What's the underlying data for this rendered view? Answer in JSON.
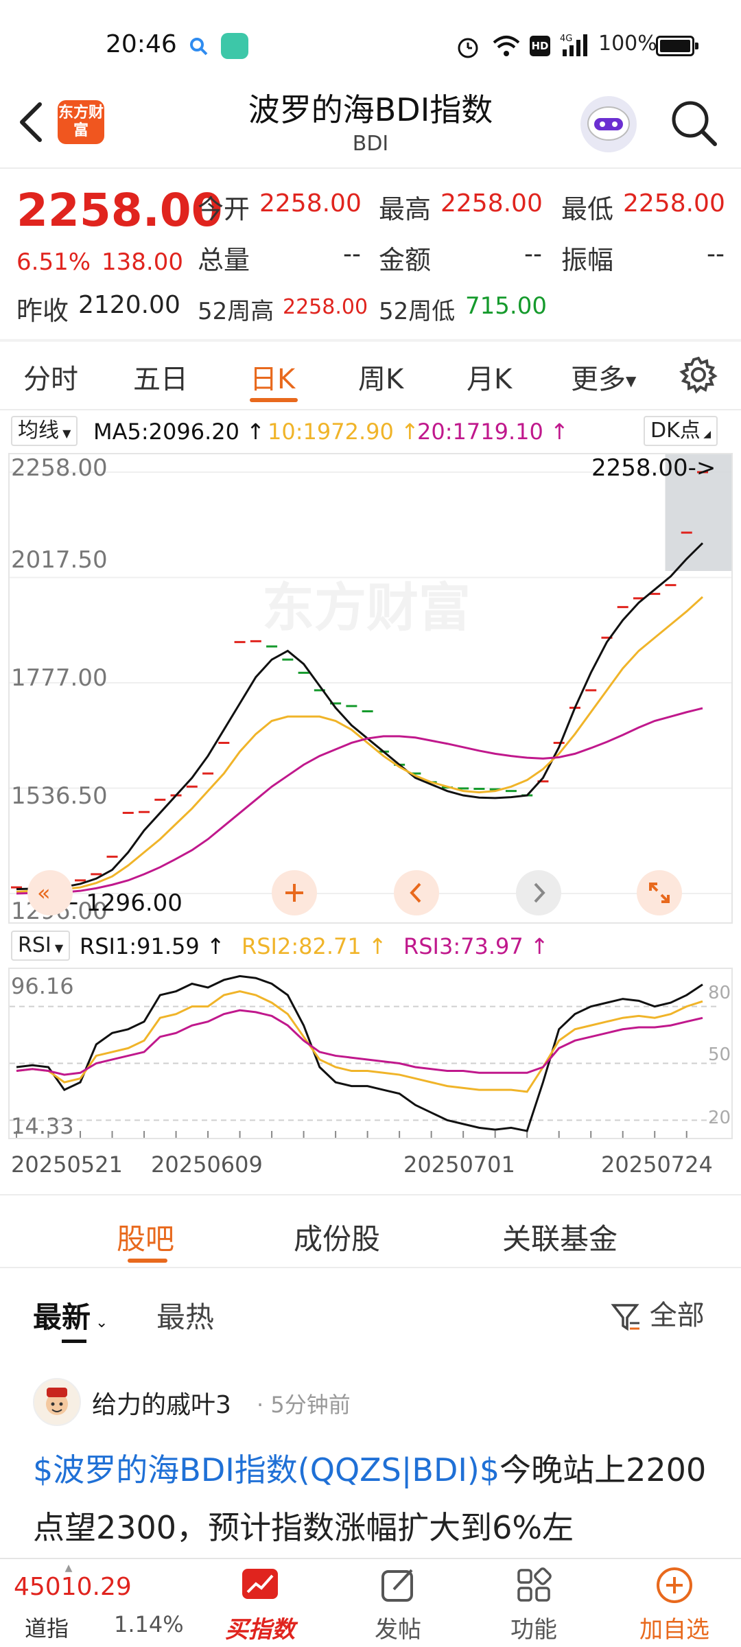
{
  "status_bar": {
    "time": "20:46",
    "network": "4G",
    "battery": "100%"
  },
  "header": {
    "title": "波罗的海BDI指数",
    "subtitle": "BDI",
    "logo_text": "东方财富"
  },
  "quote": {
    "price": "2258.00",
    "change_pct": "6.51%",
    "change": "138.00",
    "prev_close_label": "昨收",
    "prev_close": "2120.00",
    "open_label": "今开",
    "open": "2258.00",
    "high_label": "最高",
    "high": "2258.00",
    "low_label": "最低",
    "low": "2258.00",
    "volume_label": "总量",
    "volume": "--",
    "amount_label": "金额",
    "amount": "--",
    "amplitude_label": "振幅",
    "amplitude": "--",
    "w52_high_label": "52周高",
    "w52_high": "2258.00",
    "w52_low_label": "52周低",
    "w52_low": "715.00"
  },
  "period_tabs": [
    "分时",
    "五日",
    "日K",
    "周K",
    "月K",
    "更多"
  ],
  "active_period": "日K",
  "ma_legend": {
    "selector": "均线",
    "ma5": "MA5:2096.20",
    "ma10": "10:1972.90",
    "ma20": "20:1719.10",
    "dk_label": "DK点"
  },
  "rsi_legend": {
    "selector": "RSI",
    "rsi1": "RSI1:91.59",
    "rsi2": "RSI2:82.71",
    "rsi3": "RSI3:73.97"
  },
  "colors": {
    "up": "#e0241e",
    "down": "#159a2c",
    "ma5": "#111111",
    "ma10": "#f0b429",
    "ma20": "#c0188c",
    "accent": "#e8691d"
  },
  "chart_data": [
    {
      "type": "line",
      "y_ticks": [
        "2258.00",
        "2017.50",
        "1777.00",
        "1536.50",
        "1296.00"
      ],
      "ylim": [
        1296,
        2258
      ],
      "price_marker": "2258.00->",
      "low_marker": "1296.00",
      "x": [
        0,
        1,
        2,
        3,
        4,
        5,
        6,
        7,
        8,
        9,
        10,
        11,
        12,
        13,
        14,
        15,
        16,
        17,
        18,
        19,
        20,
        21,
        22,
        23,
        24,
        25,
        26,
        27,
        28,
        29,
        30,
        31,
        32,
        33,
        34,
        35,
        36,
        37,
        38,
        39,
        40,
        41,
        42,
        43
      ],
      "closes": [
        1310,
        1305,
        1300,
        1318,
        1326,
        1340,
        1380,
        1480,
        1482,
        1510,
        1520,
        1540,
        1570,
        1640,
        1870,
        1872,
        1860,
        1830,
        1800,
        1760,
        1730,
        1724,
        1712,
        1620,
        1590,
        1570,
        1550,
        1538,
        1536,
        1535,
        1534,
        1530,
        1520,
        1552,
        1640,
        1720,
        1760,
        1880,
        1950,
        1970,
        1980,
        2000,
        2120,
        2258
      ],
      "series": [
        {
          "name": "MA5",
          "values": [
            1306,
            1307,
            1308,
            1311,
            1318,
            1330,
            1350,
            1390,
            1440,
            1480,
            1520,
            1560,
            1610,
            1670,
            1730,
            1790,
            1830,
            1850,
            1820,
            1770,
            1720,
            1680,
            1650,
            1620,
            1590,
            1560,
            1545,
            1530,
            1520,
            1515,
            1514,
            1516,
            1520,
            1560,
            1630,
            1720,
            1800,
            1870,
            1920,
            1960,
            1990,
            2020,
            2060,
            2096
          ]
        },
        {
          "name": "MA10",
          "values": [
            1300,
            1302,
            1304,
            1306,
            1310,
            1320,
            1335,
            1360,
            1390,
            1420,
            1455,
            1490,
            1530,
            1570,
            1620,
            1660,
            1690,
            1700,
            1700,
            1700,
            1690,
            1670,
            1640,
            1610,
            1585,
            1565,
            1550,
            1540,
            1530,
            1527,
            1530,
            1540,
            1555,
            1580,
            1615,
            1660,
            1710,
            1760,
            1810,
            1850,
            1880,
            1910,
            1940,
            1973
          ]
        },
        {
          "name": "MA20",
          "values": [
            1296,
            1297,
            1298,
            1299,
            1302,
            1308,
            1316,
            1326,
            1340,
            1356,
            1375,
            1395,
            1420,
            1450,
            1480,
            1510,
            1540,
            1565,
            1590,
            1610,
            1625,
            1640,
            1650,
            1655,
            1655,
            1652,
            1645,
            1638,
            1630,
            1622,
            1615,
            1610,
            1606,
            1604,
            1607,
            1615,
            1628,
            1642,
            1658,
            1675,
            1690,
            1700,
            1710,
            1719
          ]
        }
      ]
    },
    {
      "type": "line",
      "title": "RSI",
      "y_ticks_left": [
        "96.16",
        "14.33"
      ],
      "y_ticks_right": [
        "80",
        "50",
        "20"
      ],
      "ylim": [
        14.33,
        96.16
      ],
      "x_labels": [
        "20250521",
        "20250609",
        "20250701",
        "20250724"
      ],
      "series": [
        {
          "name": "RSI1",
          "values": [
            48,
            49,
            48,
            36,
            40,
            60,
            66,
            68,
            72,
            86,
            88,
            92,
            90,
            94,
            96,
            95,
            92,
            86,
            70,
            48,
            40,
            38,
            38,
            36,
            34,
            28,
            24,
            20,
            18,
            16,
            15,
            16,
            14,
            40,
            68,
            76,
            80,
            82,
            84,
            83,
            80,
            82,
            86,
            91.59
          ]
        },
        {
          "name": "RSI2",
          "values": [
            46,
            47,
            46,
            40,
            42,
            54,
            56,
            58,
            62,
            74,
            76,
            80,
            80,
            86,
            88,
            86,
            82,
            76,
            64,
            52,
            48,
            46,
            46,
            45,
            44,
            42,
            40,
            38,
            37,
            36,
            36,
            36,
            35,
            48,
            62,
            68,
            70,
            72,
            74,
            75,
            74,
            76,
            80,
            82.71
          ]
        },
        {
          "name": "RSI3",
          "values": [
            46,
            47,
            46,
            44,
            45,
            50,
            52,
            54,
            56,
            64,
            66,
            70,
            72,
            76,
            78,
            77,
            75,
            70,
            62,
            56,
            54,
            53,
            52,
            51,
            50,
            48,
            47,
            46,
            46,
            45,
            45,
            45,
            45,
            48,
            58,
            62,
            64,
            66,
            68,
            69,
            69,
            70,
            72,
            73.97
          ]
        }
      ]
    }
  ],
  "bottom_tabs": [
    "股吧",
    "成份股",
    "关联基金"
  ],
  "feed_sort": {
    "latest": "最新",
    "hot": "最热",
    "filter": "全部"
  },
  "post": {
    "author": "给力的戚叶3",
    "time": "· 5分钟前",
    "link_text": "$波罗的海BDI指数(QQZS|BDI)$",
    "body": "今晚站上2200点望2300，预计指数涨幅扩大到6%左"
  },
  "bottom_bar": {
    "index_value": "45010.29",
    "index_name": "道指",
    "index_change": "1.14%",
    "buy_label": "买指数",
    "post_label": "发帖",
    "func_label": "功能",
    "add_label": "加自选"
  }
}
